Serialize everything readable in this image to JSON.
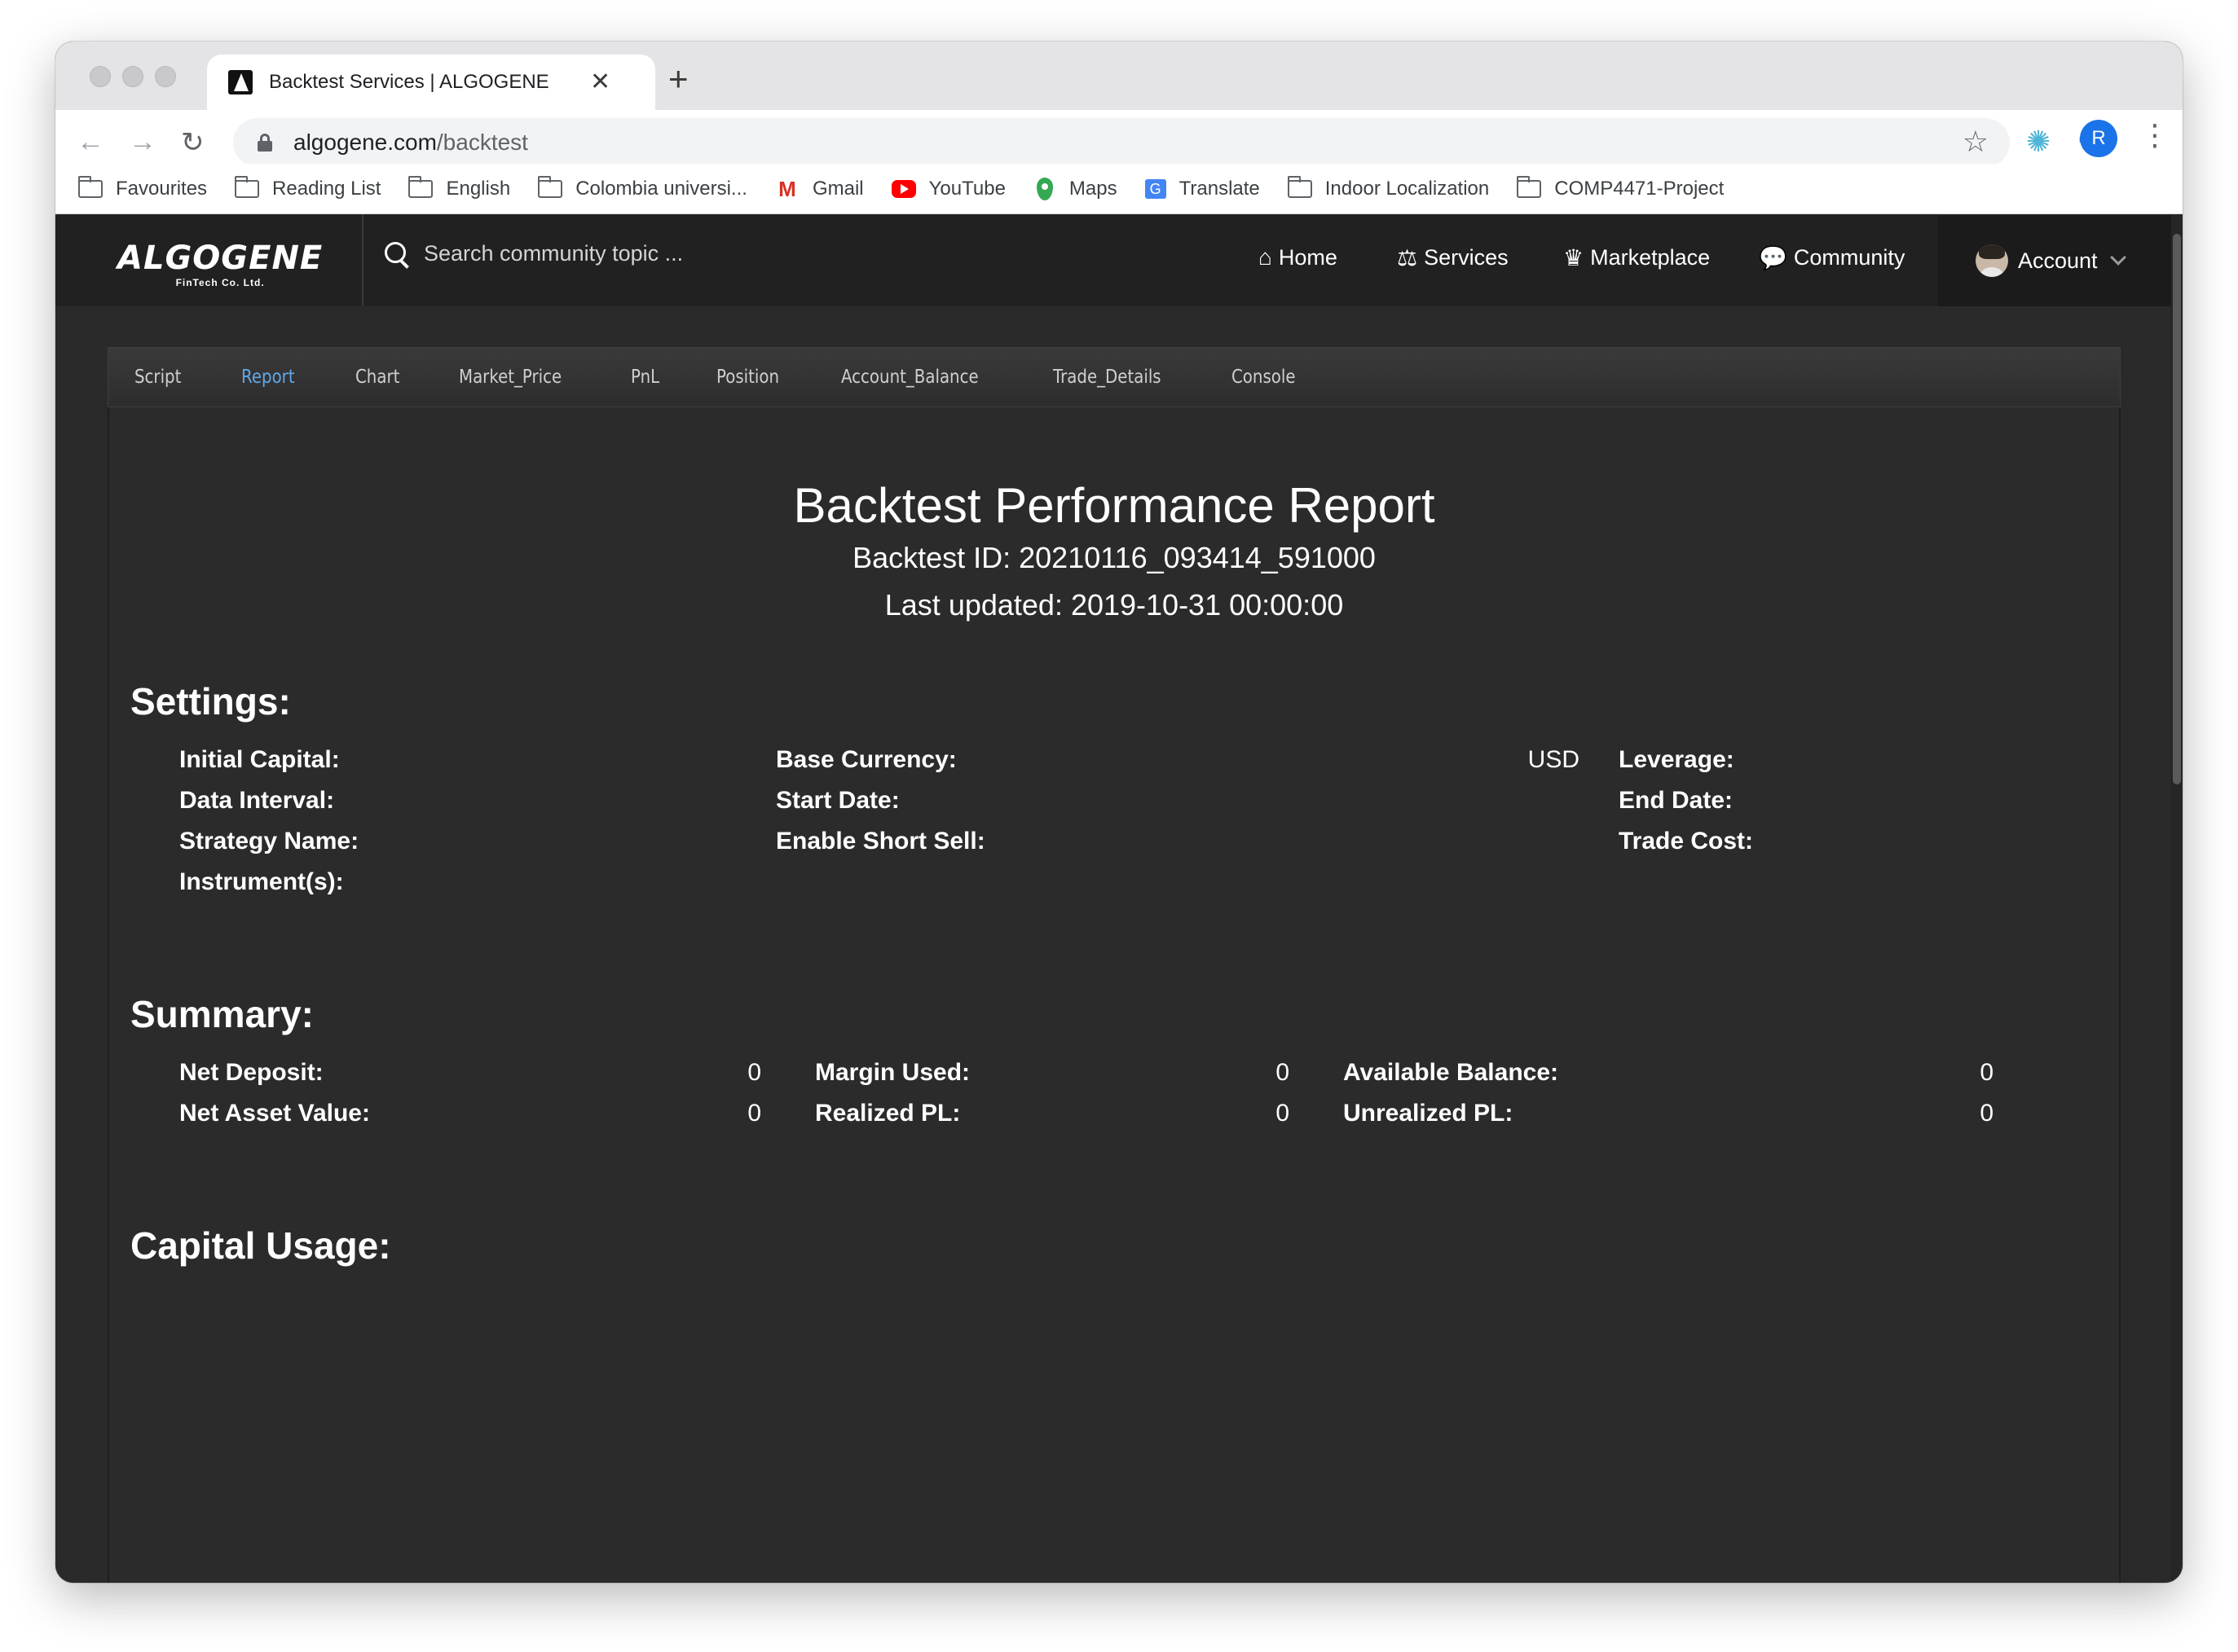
{
  "browser": {
    "tab_title": "Backtest Services | ALGOGENE",
    "url_host": "algogene.com",
    "url_path": "/backtest",
    "profile_initial": "R",
    "bookmarks": [
      {
        "label": "Favourites",
        "icon": "folder-icon"
      },
      {
        "label": "Reading List",
        "icon": "folder-icon"
      },
      {
        "label": "English",
        "icon": "folder-icon"
      },
      {
        "label": "Colombia universi...",
        "icon": "folder-icon"
      },
      {
        "label": "Gmail",
        "icon": "gmail-icon"
      },
      {
        "label": "YouTube",
        "icon": "youtube-icon"
      },
      {
        "label": "Maps",
        "icon": "maps-icon"
      },
      {
        "label": "Translate",
        "icon": "translate-icon"
      },
      {
        "label": "Indoor Localization",
        "icon": "folder-icon"
      },
      {
        "label": "COMP4471-Project",
        "icon": "folder-icon"
      }
    ]
  },
  "site": {
    "logo": "ALGOGENE",
    "logo_sub": "FinTech Co. Ltd.",
    "search_placeholder": "Search community topic ...",
    "nav": {
      "home": "Home",
      "services": "Services",
      "marketplace": "Marketplace",
      "community": "Community",
      "account": "Account"
    }
  },
  "subtabs": [
    "Script",
    "Report",
    "Chart",
    "Market_Price",
    "PnL",
    "Position",
    "Account_Balance",
    "Trade_Details",
    "Console"
  ],
  "active_subtab": "Report",
  "report": {
    "title": "Backtest Performance Report",
    "backtest_id": "Backtest ID: 20210116_093414_591000",
    "last_updated": "Last updated: 2019-10-31 00:00:00",
    "settings": {
      "heading": "Settings:",
      "initial_capital": "Initial Capital:",
      "base_currency": "Base Currency:",
      "base_currency_value": "USD",
      "leverage": "Leverage:",
      "data_interval": "Data Interval:",
      "start_date": "Start Date:",
      "end_date": "End Date:",
      "strategy_name": "Strategy Name:",
      "enable_short_sell": "Enable Short Sell:",
      "trade_cost": "Trade Cost:",
      "instruments": "Instrument(s):"
    },
    "summary": {
      "heading": "Summary:",
      "net_deposit": "Net Deposit:",
      "net_deposit_value": "0",
      "margin_used": "Margin Used:",
      "margin_used_value": "0",
      "available_balance": "Available Balance:",
      "available_balance_value": "0",
      "net_asset_value": "Net Asset Value:",
      "net_asset_value_value": "0",
      "realized_pl": "Realized PL:",
      "realized_pl_value": "0",
      "unrealized_pl": "Unrealized PL:",
      "unrealized_pl_value": "0"
    },
    "capital_usage": {
      "heading": "Capital Usage:"
    }
  },
  "colors": {
    "header_bg": "#212122",
    "content_bg": "#2a2a2b",
    "active_tab": "#5fa8e8"
  }
}
